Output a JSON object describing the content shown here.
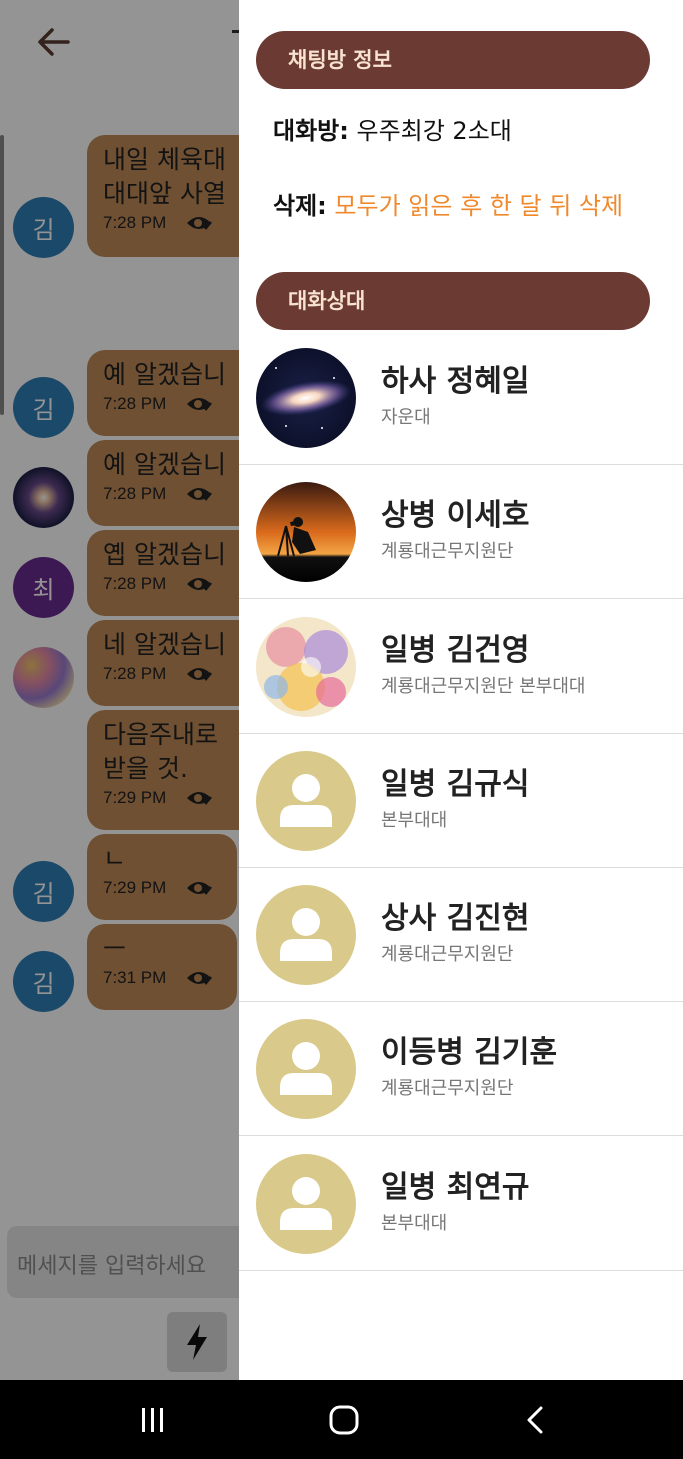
{
  "chat": {
    "input_placeholder": "메세지를 입력하세요",
    "messages": [
      {
        "avatar": "김",
        "avatar_color": "#2f7fb5",
        "text": "내일 체육대\n대대앞 사열",
        "time": "7:28 PM"
      },
      {
        "avatar": "김",
        "avatar_color": "#2f7fb5",
        "text": "예 알겠습니",
        "time": "7:28 PM"
      },
      {
        "avatar": "",
        "avatar_color": "galaxy",
        "text": "예 알겠습니",
        "time": "7:28 PM"
      },
      {
        "avatar": "최",
        "avatar_color": "#6a2c91",
        "text": "옙 알겠습니",
        "time": "7:28 PM"
      },
      {
        "avatar": "",
        "avatar_color": "watercolor",
        "text": "네 알겠습니",
        "time": "7:28 PM"
      },
      {
        "avatar": "",
        "avatar_color": "none",
        "text": "다음주내로\n받을 것.",
        "time": "7:29 PM"
      },
      {
        "avatar": "김",
        "avatar_color": "#2f7fb5",
        "text": "ㄴ",
        "time": "7:29 PM"
      },
      {
        "avatar": "김",
        "avatar_color": "#2f7fb5",
        "text": "ㅡ",
        "time": "7:31 PM"
      }
    ]
  },
  "drawer": {
    "info_header": "채팅방 정보",
    "room_label": "대화방:",
    "room_value": "우주최강 2소대",
    "delete_label": "삭제:",
    "delete_value": "모두가 읽은 후 한 달 뒤 삭제",
    "members_header": "대화상대",
    "members": [
      {
        "name": "하사 정혜일",
        "unit": "자운대",
        "avatar": "galaxy"
      },
      {
        "name": "상병 이세호",
        "unit": "계룡대근무지원단",
        "avatar": "sunset-photographer"
      },
      {
        "name": "일병 김건영",
        "unit": "계룡대근무지원단 본부대대",
        "avatar": "watercolor"
      },
      {
        "name": "일병 김규식",
        "unit": "본부대대",
        "avatar": "default-person"
      },
      {
        "name": "상사 김진현",
        "unit": "계룡대근무지원단",
        "avatar": "default-person"
      },
      {
        "name": "이등병 김기훈",
        "unit": "계룡대근무지원단",
        "avatar": "default-person"
      },
      {
        "name": "일병 최연규",
        "unit": "본부대대",
        "avatar": "default-person"
      }
    ]
  },
  "colors": {
    "pill": "#6b3a33",
    "accent": "#f0892c",
    "bubble": "#c08a57",
    "default_avatar": "#d9c98a"
  },
  "icons": [
    "back-arrow-icon",
    "eye-check-icon",
    "bolt-icon",
    "recent-apps-icon",
    "home-icon",
    "nav-back-icon",
    "person-icon"
  ]
}
